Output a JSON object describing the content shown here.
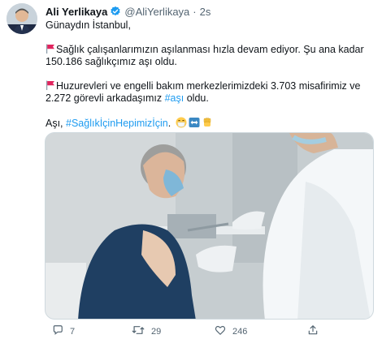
{
  "user": {
    "name": "Ali Yerlikaya",
    "handle": "@AliYerlikaya",
    "separator": "·",
    "time": "2s"
  },
  "tweet": {
    "greeting": "Günaydın İstanbul,",
    "para1": "Sağlık çalışanlarımızın aşılanması hızla devam ediyor.  Şu ana kadar 150.186 sağlıkçımız aşı oldu.",
    "para2_before": "Huzurevleri ve engelli bakım merkezlerimizdeki 3.703 misafirimiz ve 2.272 görevli arkadaşımız ",
    "para2_hashtag": "#aşı",
    "para2_after": " oldu.",
    "para3_before": "Aşı, ",
    "para3_hashtag": "#SağlıkİçinHepimizİçin",
    "para3_after": "."
  },
  "actions": {
    "reply_count": "7",
    "retweet_count": "29",
    "like_count": "246"
  },
  "colors": {
    "accent": "#1d9bf0",
    "flag": "#e0245e",
    "muted": "#536471"
  },
  "icons": [
    "verified-badge-icon",
    "flag-icon",
    "mask-face-icon",
    "arrows-icon",
    "raised-fist-icon",
    "reply-icon",
    "retweet-icon",
    "like-icon",
    "share-icon"
  ]
}
